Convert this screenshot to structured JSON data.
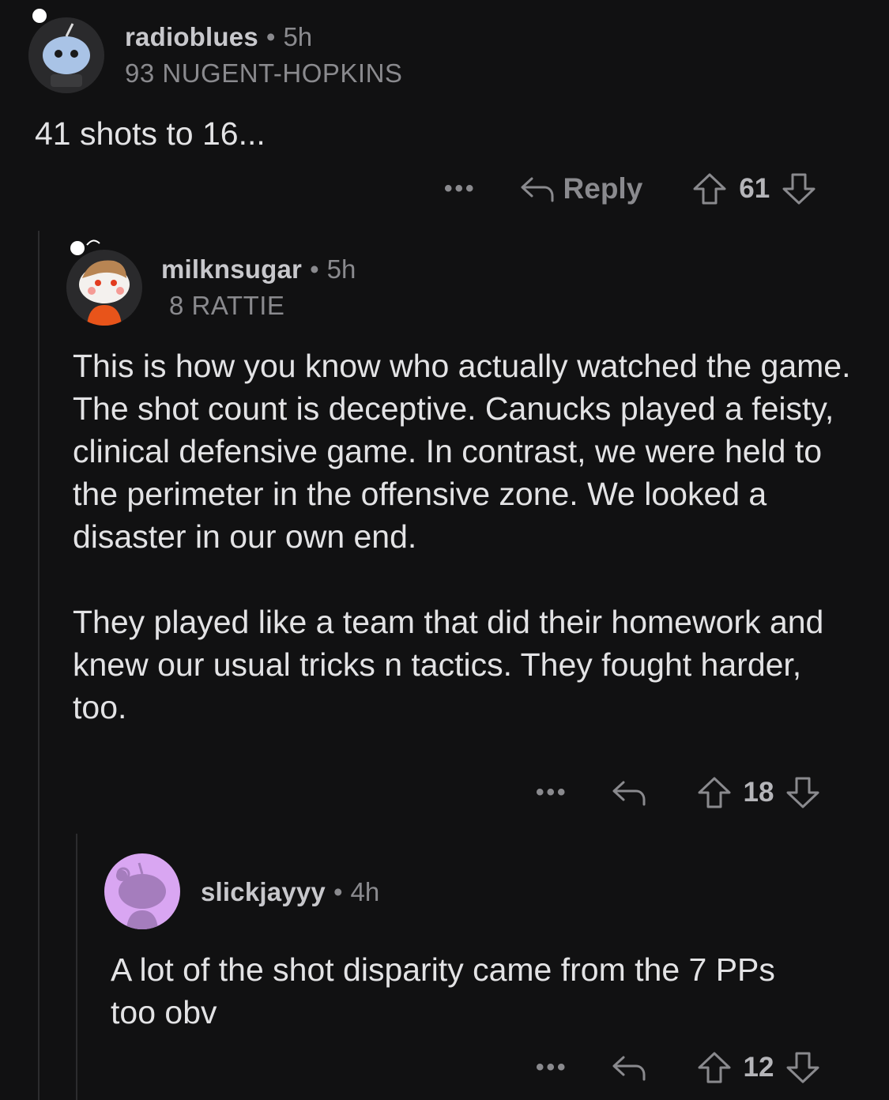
{
  "comments": [
    {
      "username": "radioblues",
      "time": "5h",
      "flair": "93 NUGENT-HOPKINS",
      "body": "41 shots to 16...",
      "reply_label": "Reply",
      "score": "61"
    },
    {
      "username": "milknsugar",
      "time": "5h",
      "flair": "8 RATTIE",
      "body": "This is how you know who actually watched the game. The shot count is deceptive. Canucks played a feisty, clinical defensive game. In contrast, we were held to the perimeter in the offensive zone. We looked a disaster in our own end.\n\nThey played like a team that did their homework and knew our usual tricks n tactics. They fought harder, too.",
      "score": "18"
    },
    {
      "username": "slickjayyy",
      "time": "4h",
      "body": "A lot of the shot disparity came from the 7 PPs too obv",
      "score": "12"
    }
  ],
  "separator": "•",
  "more_label": "•••",
  "icons": [
    "reply-arrow-icon",
    "upvote-arrow-icon",
    "downvote-arrow-icon",
    "more-options-icon"
  ],
  "colors": {
    "background": "#111112",
    "muted": "#8a8a8e",
    "text": "#e3e3e5",
    "thread_line": "#2c2c2e"
  }
}
